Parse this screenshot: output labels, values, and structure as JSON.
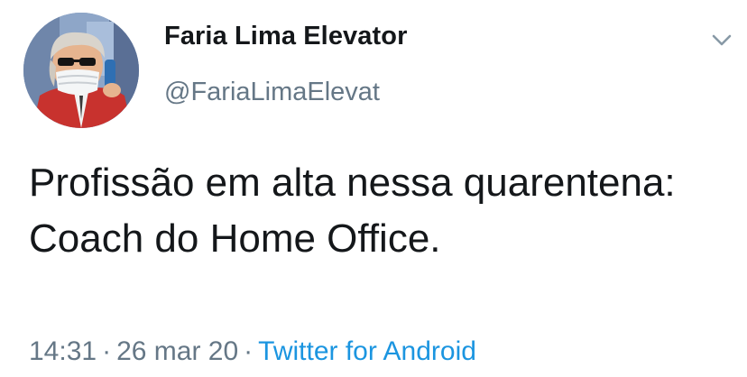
{
  "tweet": {
    "display_name": "Faria Lima Elevator",
    "handle": "@FariaLimaElevat",
    "text": "Profissão em alta nessa quarentena: Coach do Home Office.",
    "time": "14:31",
    "separator": "·",
    "date": "26 mar 20",
    "source": "Twitter for Android"
  },
  "icons": {
    "avatar": "avatar-image",
    "menu": "chevron-down-icon"
  },
  "colors": {
    "text_primary": "#14171a",
    "text_secondary": "#657786",
    "link": "#1b95e0"
  }
}
